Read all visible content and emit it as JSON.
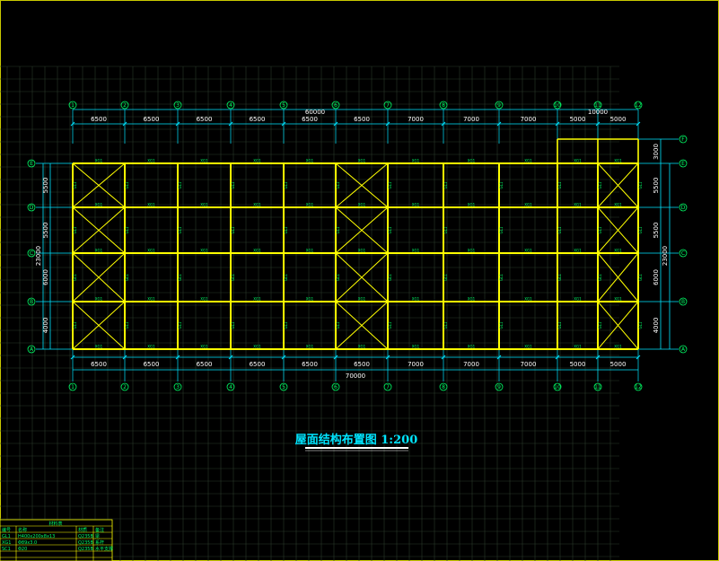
{
  "drawing": {
    "title": "屋面结构布置图 1:200",
    "grid_columns": [
      "1",
      "2",
      "3",
      "4",
      "5",
      "6",
      "7",
      "8",
      "9",
      "10",
      "11",
      "12"
    ],
    "grid_rows": [
      "A",
      "B",
      "C",
      "D",
      "E"
    ],
    "extra_row": "F",
    "top_overall_left": "60000",
    "top_overall_right": "10000",
    "top_spans": [
      "6500",
      "6500",
      "6500",
      "6500",
      "6500",
      "6500",
      "7000",
      "7000",
      "7000",
      "5000",
      "5000"
    ],
    "bottom_spans": [
      "6500",
      "6500",
      "6500",
      "6500",
      "6500",
      "6500",
      "7000",
      "7000",
      "7000",
      "5000",
      "5000"
    ],
    "bottom_overall": "70000",
    "left_dims": [
      "5500",
      "5500",
      "6000",
      "4000"
    ],
    "left_overall": "23000",
    "right_dims": [
      "5500",
      "5500",
      "6000",
      "4000"
    ],
    "right_overall": "23000",
    "right_top_dim": "3000",
    "member_labels": {
      "beam": "GL1",
      "brace": "SC1",
      "tie": "XG1"
    }
  },
  "table": {
    "header": "材料表",
    "columns": [
      "编号",
      "名称",
      "规格",
      "材质",
      "备注"
    ],
    "rows": [
      [
        "GL1",
        "H400x200x8x13",
        "",
        "Q235B",
        "梁"
      ],
      [
        "XG1",
        "Φ89x3.0",
        "",
        "Q235B",
        "系杆"
      ],
      [
        "SC1",
        "Φ20",
        "",
        "Q235B",
        "水平支撑"
      ]
    ]
  },
  "colors": {
    "yellow": "#ffff00",
    "green": "#00ff66",
    "cyan": "#00e5ff",
    "grid": "#2a3a2a"
  }
}
